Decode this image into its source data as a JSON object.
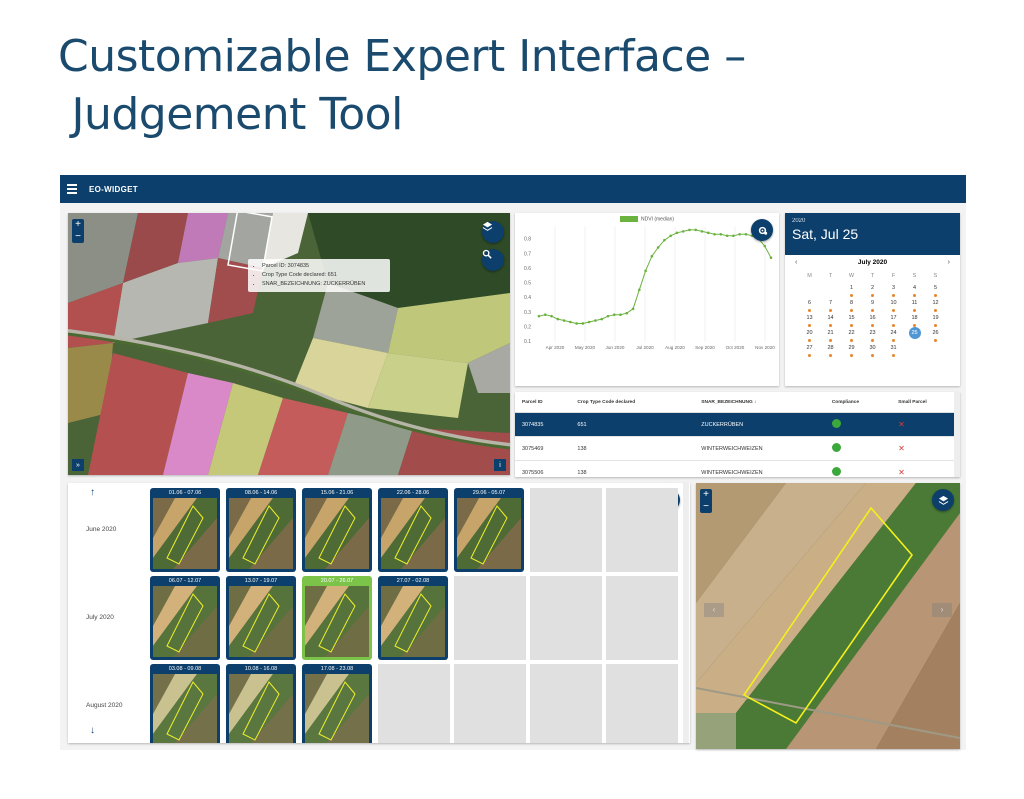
{
  "slide": {
    "title_line1": "Customizable Expert Interface –",
    "title_line2": " Judgement Tool"
  },
  "app": {
    "name": "EO-WIDGET",
    "accent": "#0c3f6b"
  },
  "map": {
    "zoom_in": "+",
    "zoom_out": "−",
    "expand": "»",
    "info": "i",
    "tooltip": {
      "parcel_id": "Parcel ID: 3074835",
      "crop_code": "Crop Type Code declared: 651",
      "snar": "SNAR_BEZEICHNUNG: ZUCKERRÜBEN"
    },
    "icons": [
      "layers-icon",
      "search-icon"
    ]
  },
  "chart_data": {
    "type": "line",
    "series": [
      {
        "name": "NDVI (median)",
        "color": "#6bb33f",
        "values": [
          0.27,
          0.28,
          0.27,
          0.25,
          0.24,
          0.23,
          0.22,
          0.22,
          0.23,
          0.24,
          0.25,
          0.27,
          0.28,
          0.28,
          0.29,
          0.32,
          0.45,
          0.58,
          0.68,
          0.74,
          0.79,
          0.82,
          0.84,
          0.85,
          0.86,
          0.86,
          0.85,
          0.84,
          0.83,
          0.83,
          0.82,
          0.82,
          0.83,
          0.83,
          0.82,
          0.8,
          0.75,
          0.67
        ]
      }
    ],
    "x_ticks": [
      "Apr 2020",
      "May 2020",
      "Jun 2020",
      "Jul 2020",
      "Aug 2020",
      "Sep 2020",
      "Oct 2020",
      "Nov 2020"
    ],
    "y_ticks": [
      "0.1",
      "0.2",
      "0.3",
      "0.4",
      "0.5",
      "0.6",
      "0.7",
      "0.8"
    ],
    "ylim": [
      0.1,
      0.88
    ],
    "grid": "vertical"
  },
  "calendar": {
    "year": "2020",
    "date_title": "Sat, Jul 25",
    "month": "July 2020",
    "prev": "‹",
    "next": "›",
    "weekdays": [
      "M",
      "T",
      "W",
      "T",
      "F",
      "S",
      "S"
    ],
    "selected": "25",
    "dot_color": "#e8842a"
  },
  "table": {
    "headers": [
      "Parcel ID",
      "Crop Type Code declared",
      "SNAR_BEZEICHNUNG ↓",
      "Compliance",
      "Small Parcel"
    ],
    "rows": [
      {
        "id": "3074835",
        "code": "651",
        "name": "ZUCKERRÜBEN"
      },
      {
        "id": "3075469",
        "code": "138",
        "name": "WINTERWEICHWEIZEN"
      },
      {
        "id": "3075506",
        "code": "138",
        "name": "WINTERWEICHWEIZEN"
      }
    ]
  },
  "thumbnails": {
    "up": "↑",
    "down": "↓",
    "months": [
      {
        "label": "June 2020",
        "tiles": [
          "01.06 - 07.06",
          "08.06 - 14.06",
          "15.06 - 21.06",
          "22.06 - 28.06",
          "29.06 - 05.07"
        ]
      },
      {
        "label": "July 2020",
        "tiles": [
          "06.07 - 12.07",
          "13.07 - 19.07",
          "20.07 - 26.07",
          "27.07 - 02.08"
        ]
      },
      {
        "label": "August 2020",
        "tiles": [
          "03.08 - 09.08",
          "10.08 - 16.08",
          "17.08 - 23.08"
        ]
      }
    ],
    "active_tile": "20.07 - 26.07"
  },
  "bigmap": {
    "zoom_in": "+",
    "zoom_out": "−"
  }
}
